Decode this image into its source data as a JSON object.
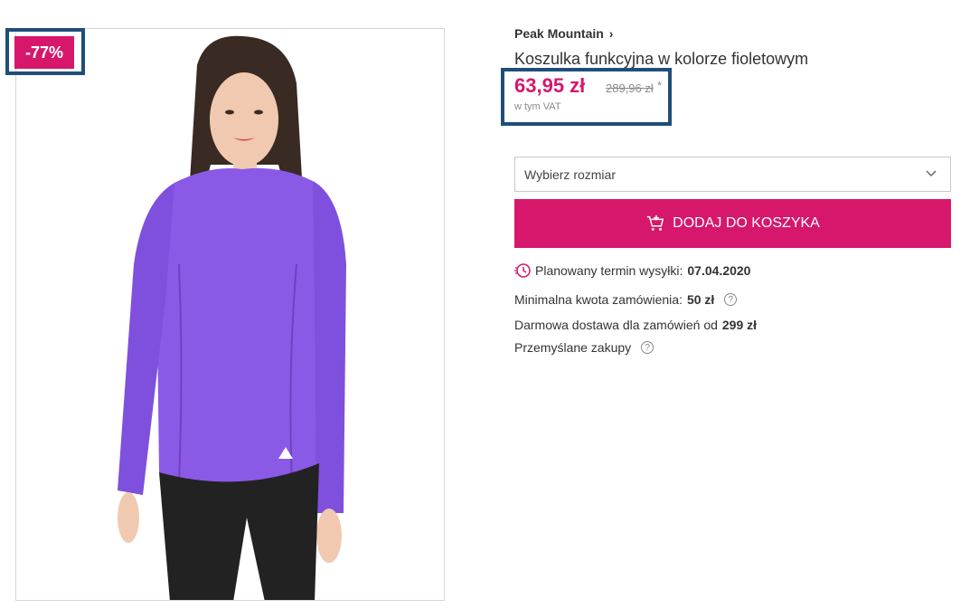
{
  "product": {
    "discount_badge": "-77%",
    "image_icon": "model-purple-longsleeve-shirt-photo",
    "brand": "Peak Mountain",
    "brand_chevron": "›",
    "title": "Koszulka funkcyjna w kolorze fioletowym"
  },
  "price": {
    "current": "63,95 zł",
    "old": "289,96 zł",
    "old_marker": "*",
    "vat_note": "w tym VAT"
  },
  "size_select": {
    "placeholder": "Wybierz rozmiar",
    "icon": "chevron-down-icon"
  },
  "cart_button": {
    "label": "DODAJ DO KOSZYKA",
    "icon": "cart-plus-icon"
  },
  "info": {
    "shipping_label": "Planowany termin wysyłki:",
    "shipping_date": "07.04.2020",
    "min_order_label": "Minimalna kwota zamówienia:",
    "min_order_value": "50 zł",
    "free_shipping_label": "Darmowa dostawa dla zamówień od",
    "free_shipping_value": "299 zł",
    "smart_shopping_label": "Przemyślane zakupy",
    "help_glyph": "?"
  },
  "colors": {
    "accent": "#d6176b",
    "highlight_box": "#1f4e79",
    "shirt": "#8a5ae6"
  }
}
